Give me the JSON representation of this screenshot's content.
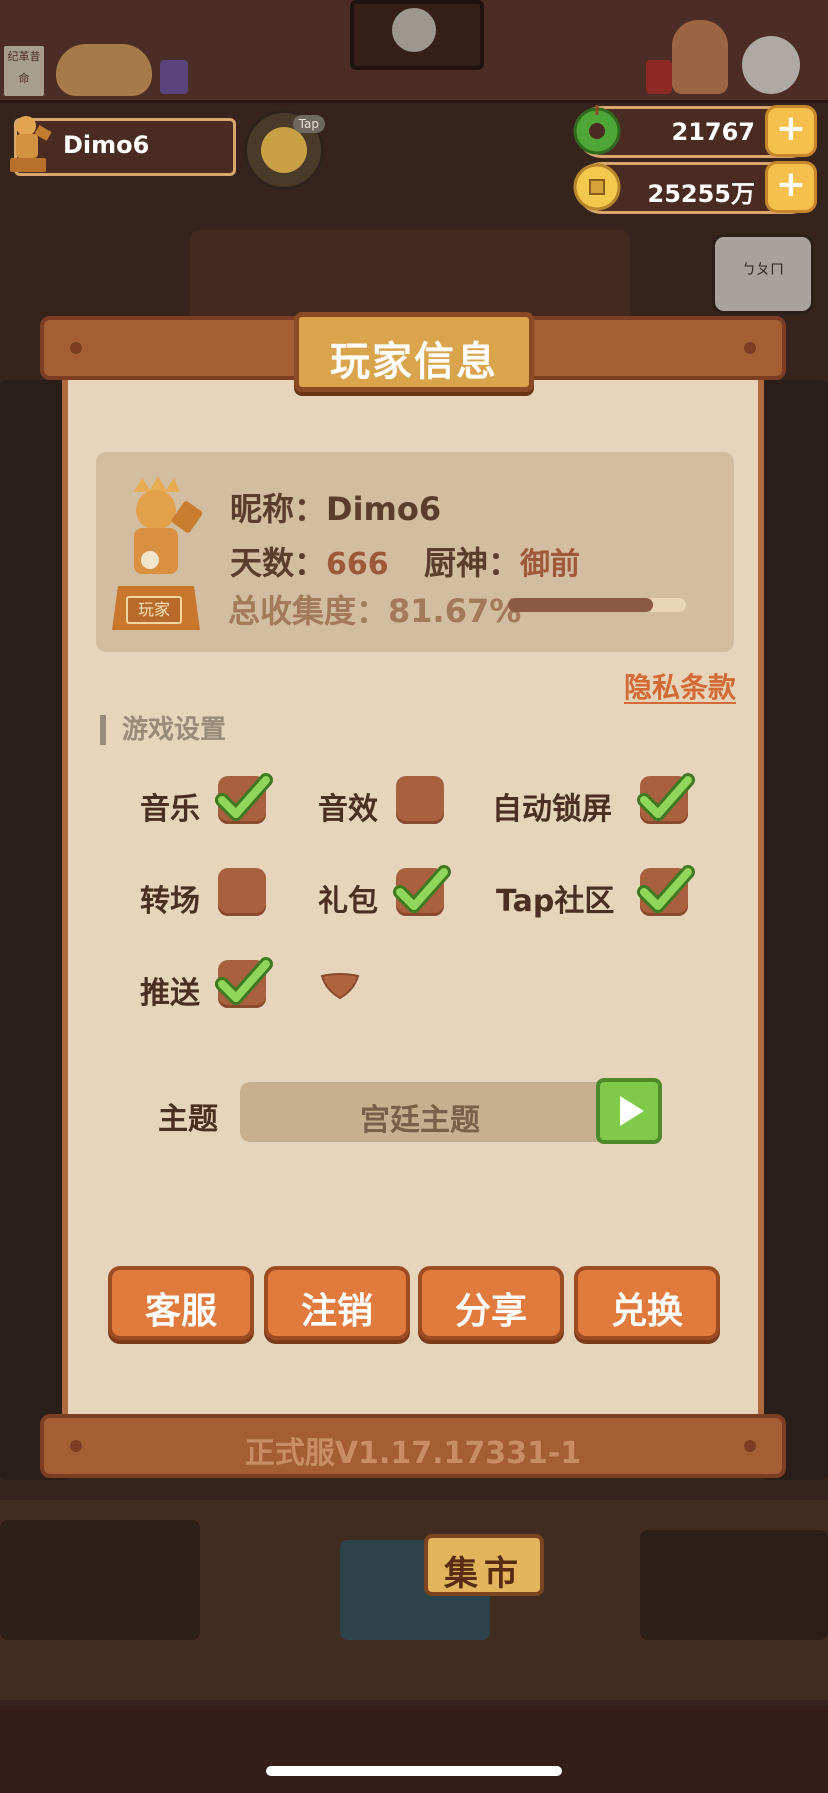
{
  "hud": {
    "player_name": "Dimo6",
    "tap_badge": "Tap",
    "jade_amount": "21767",
    "coin_amount": "25255万",
    "plus_label": "+"
  },
  "dialog": {
    "title": "玩家信息",
    "nickname_label": "昵称：",
    "nickname_value": "Dimo6",
    "days_label": "天数：",
    "days_value": "666",
    "chef_label": "厨神：",
    "chef_value": "御前",
    "collection_label": "总收集度：",
    "collection_value": "81.67%",
    "collection_progress": 0.8167,
    "trophy_plaque": "玩家",
    "privacy_link": "隐私条款",
    "settings_header": "游戏设置",
    "settings": [
      {
        "label": "音乐",
        "checked": true
      },
      {
        "label": "音效",
        "checked": false
      },
      {
        "label": "自动锁屏",
        "checked": true
      },
      {
        "label": "转场",
        "checked": false
      },
      {
        "label": "礼包",
        "checked": true
      },
      {
        "label": "Tap社区",
        "checked": true
      },
      {
        "label": "推送",
        "checked": true
      }
    ],
    "theme_label": "主题",
    "theme_value": "宫廷主题",
    "buttons": {
      "service": "客服",
      "logout": "注销",
      "share": "分享",
      "redeem": "兑换"
    },
    "version": "正式服V1.17.17331-1"
  },
  "scene": {
    "top_sign": "纪革昔命",
    "market_sign": "集市",
    "speech_bubble": "ㄅㄆㄇ"
  },
  "colors": {
    "accent_orange": "#e07a3d",
    "check_green": "#7fc94b",
    "panel_bg": "#e6d5bb",
    "privacy_link": "#d46a35"
  }
}
